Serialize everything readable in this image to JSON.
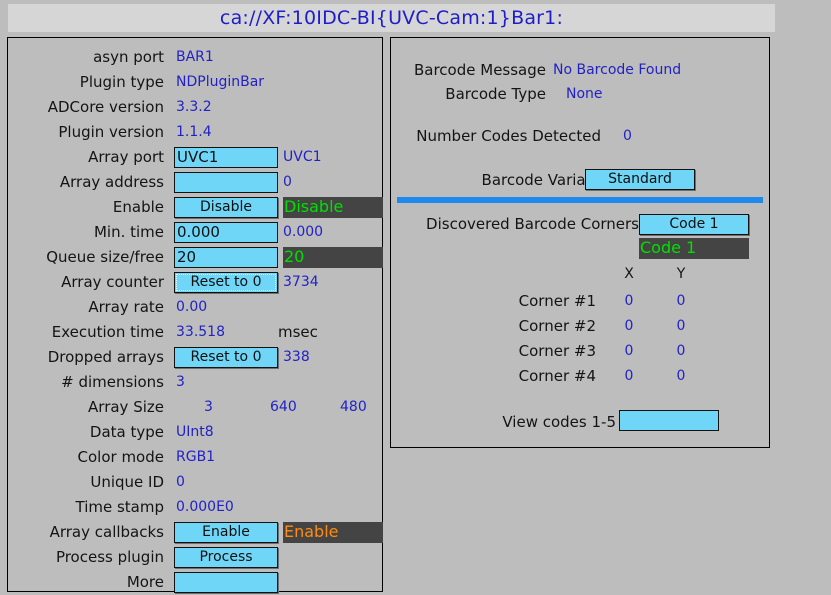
{
  "window": {
    "title": "ca://XF:10IDC-BI{UVC-Cam:1}Bar1:"
  },
  "left_panel": {
    "rows": [
      {
        "label": "asyn port",
        "value": "BAR1"
      },
      {
        "label": "Plugin type",
        "value": "NDPluginBar"
      },
      {
        "label": "ADCore version",
        "value": "3.3.2"
      },
      {
        "label": "Plugin version",
        "value": "1.1.4"
      },
      {
        "label": "Array port",
        "entry": "UVC1",
        "value": "UVC1"
      },
      {
        "label": "Array address",
        "entry": "",
        "value": "0"
      },
      {
        "label": "Enable",
        "button": "Disable",
        "readback": "Disable",
        "readback_color": "green"
      },
      {
        "label": "Min. time",
        "entry": "0.000",
        "value": "0.000"
      },
      {
        "label": "Queue size/free",
        "entry": "20",
        "readback": "20",
        "readback_color": "green"
      },
      {
        "label": "Array counter",
        "button": "Reset to 0",
        "focused": true,
        "value": "3734"
      },
      {
        "label": "Array rate",
        "value": "0.00"
      },
      {
        "label": "Execution time",
        "value": "33.518",
        "units": "msec"
      },
      {
        "label": "Dropped arrays",
        "button": "Reset to 0",
        "value": "338"
      },
      {
        "label": "# dimensions",
        "value": "3"
      },
      {
        "label": "Array Size",
        "value": "3",
        "value2": "640",
        "value3": "480"
      },
      {
        "label": "Data type",
        "value": "UInt8"
      },
      {
        "label": "Color mode",
        "value": "RGB1"
      },
      {
        "label": "Unique ID",
        "value": "0"
      },
      {
        "label": "Time stamp",
        "value": "0.000E0"
      },
      {
        "label": "Array callbacks",
        "button": "Enable",
        "readback": "Enable",
        "readback_color": "orange"
      },
      {
        "label": "Process plugin",
        "button": "Process"
      },
      {
        "label": "More",
        "button": ""
      }
    ]
  },
  "right_panel": {
    "barcode_message_label": "Barcode Message",
    "barcode_message_value": "No Barcode Found",
    "barcode_type_label": "Barcode Type",
    "barcode_type_value": "None",
    "number_codes_label": "Number Codes Detected",
    "number_codes_value": "0",
    "barcode_variant_label": "Barcode Variant",
    "barcode_variant_button": "Standard",
    "discovered_corners_label": "Discovered Barcode Corners",
    "code_select_button": "Code 1",
    "code_readback": "Code 1",
    "col_x": "X",
    "col_y": "Y",
    "corners": [
      {
        "label": "Corner #1",
        "x": "0",
        "y": "0"
      },
      {
        "label": "Corner #2",
        "x": "0",
        "y": "0"
      },
      {
        "label": "Corner #3",
        "x": "0",
        "y": "0"
      },
      {
        "label": "Corner #4",
        "x": "0",
        "y": "0"
      }
    ],
    "view_codes_label": "View codes 1-5",
    "view_codes_entry": ""
  },
  "colors": {
    "background": "#bdbdbd",
    "title_text": "#1e1ec8",
    "value_text": "#2222c4",
    "widget_cyan": "#6fd6f7",
    "readback_bg": "#444444",
    "readback_green": "#00e000",
    "readback_orange": "#ff8c10",
    "separator_blue": "#1e8aee"
  }
}
